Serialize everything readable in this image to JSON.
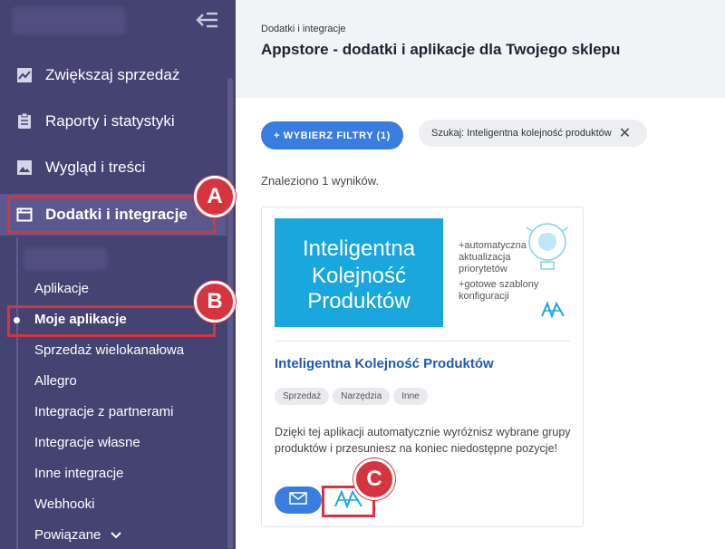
{
  "sidebar": {
    "nav": [
      {
        "label": "Zwiększaj sprzedaż",
        "icon": "chart-line-icon"
      },
      {
        "label": "Raporty i statystyki",
        "icon": "clipboard-icon"
      },
      {
        "label": "Wygląd i treści",
        "icon": "image-icon"
      },
      {
        "label": "Dodatki i integracje",
        "icon": "window-icon",
        "active": true
      }
    ],
    "sub": [
      {
        "label": "Aplikacje"
      },
      {
        "label": "Moje aplikacje",
        "current": true
      },
      {
        "label": "Sprzedaż wielokanałowa"
      },
      {
        "label": "Allegro"
      },
      {
        "label": "Integracje z partnerami"
      },
      {
        "label": "Integracje własne"
      },
      {
        "label": "Inne integracje"
      },
      {
        "label": "Webhooki"
      },
      {
        "label": "Powiązane"
      }
    ]
  },
  "header": {
    "breadcrumb": "Dodatki i integracje",
    "title": "Appstore - dodatki i aplikacje dla Twojego sklepu"
  },
  "main": {
    "filter_button": "+ WYBIERZ FILTRY (1)",
    "search_chip": "Szukaj: Inteligentna kolejność produktów",
    "results": "Znaleziono 1 wyników."
  },
  "card": {
    "banner_line1": "Inteligentna",
    "banner_line2": "Kolejność",
    "banner_line3": "Produktów",
    "banner_feature1": "+automatyczna aktualizacja priorytetów",
    "banner_feature2": "+gotowe szablony konfiguracji",
    "title": "Inteligentna Kolejność Produktów",
    "tags": [
      "Sprzedaż",
      "Narzędzia",
      "Inne"
    ],
    "description": "Dzięki tej aplikacji automatycznie wyróżnisz wybrane grupy produktów i przesuniesz na koniec niedostępne pozycje!"
  },
  "annotations": {
    "a": "A",
    "b": "B",
    "c": "C"
  },
  "colors": {
    "sidebar": "#454372",
    "accent": "#3a7de0",
    "highlight": "#d6343f",
    "banner": "#1aa7de"
  }
}
